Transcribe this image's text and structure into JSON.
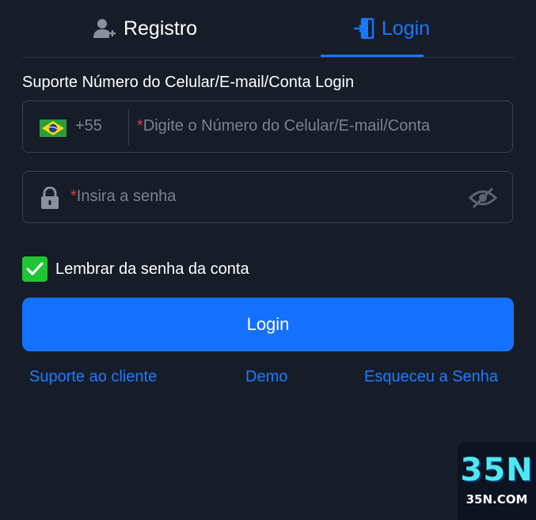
{
  "tabs": {
    "register": {
      "label": "Registro",
      "icon": "user-plus-icon"
    },
    "login": {
      "label": "Login",
      "icon": "login-door-icon",
      "active": true
    }
  },
  "form": {
    "support_label": "Suporte Número do Celular/E-mail/Conta Login",
    "phone": {
      "country_flag": "brazil-flag-icon",
      "dial_code": "+55",
      "required_mark": "*",
      "placeholder": "Digite o Número do Celular/E-mail/Conta"
    },
    "password": {
      "icon": "lock-icon",
      "required_mark": "*",
      "placeholder": "Insira a senha",
      "visibility_icon": "eye-off-icon"
    },
    "remember": {
      "label": "Lembrar da senha da conta",
      "checked": true
    },
    "login_button": "Login"
  },
  "links": {
    "support": "Suporte ao cliente",
    "demo": "Demo",
    "forgot": "Esqueceu a Senha"
  },
  "badge": {
    "big": "35N",
    "small": "35N.COM"
  },
  "colors": {
    "background": "#161d29",
    "accent": "#1470ff",
    "link": "#1d7bff",
    "checkbox": "#20c434",
    "required": "#e23c3c",
    "placeholder": "#7a8290",
    "border": "#3a4150"
  }
}
